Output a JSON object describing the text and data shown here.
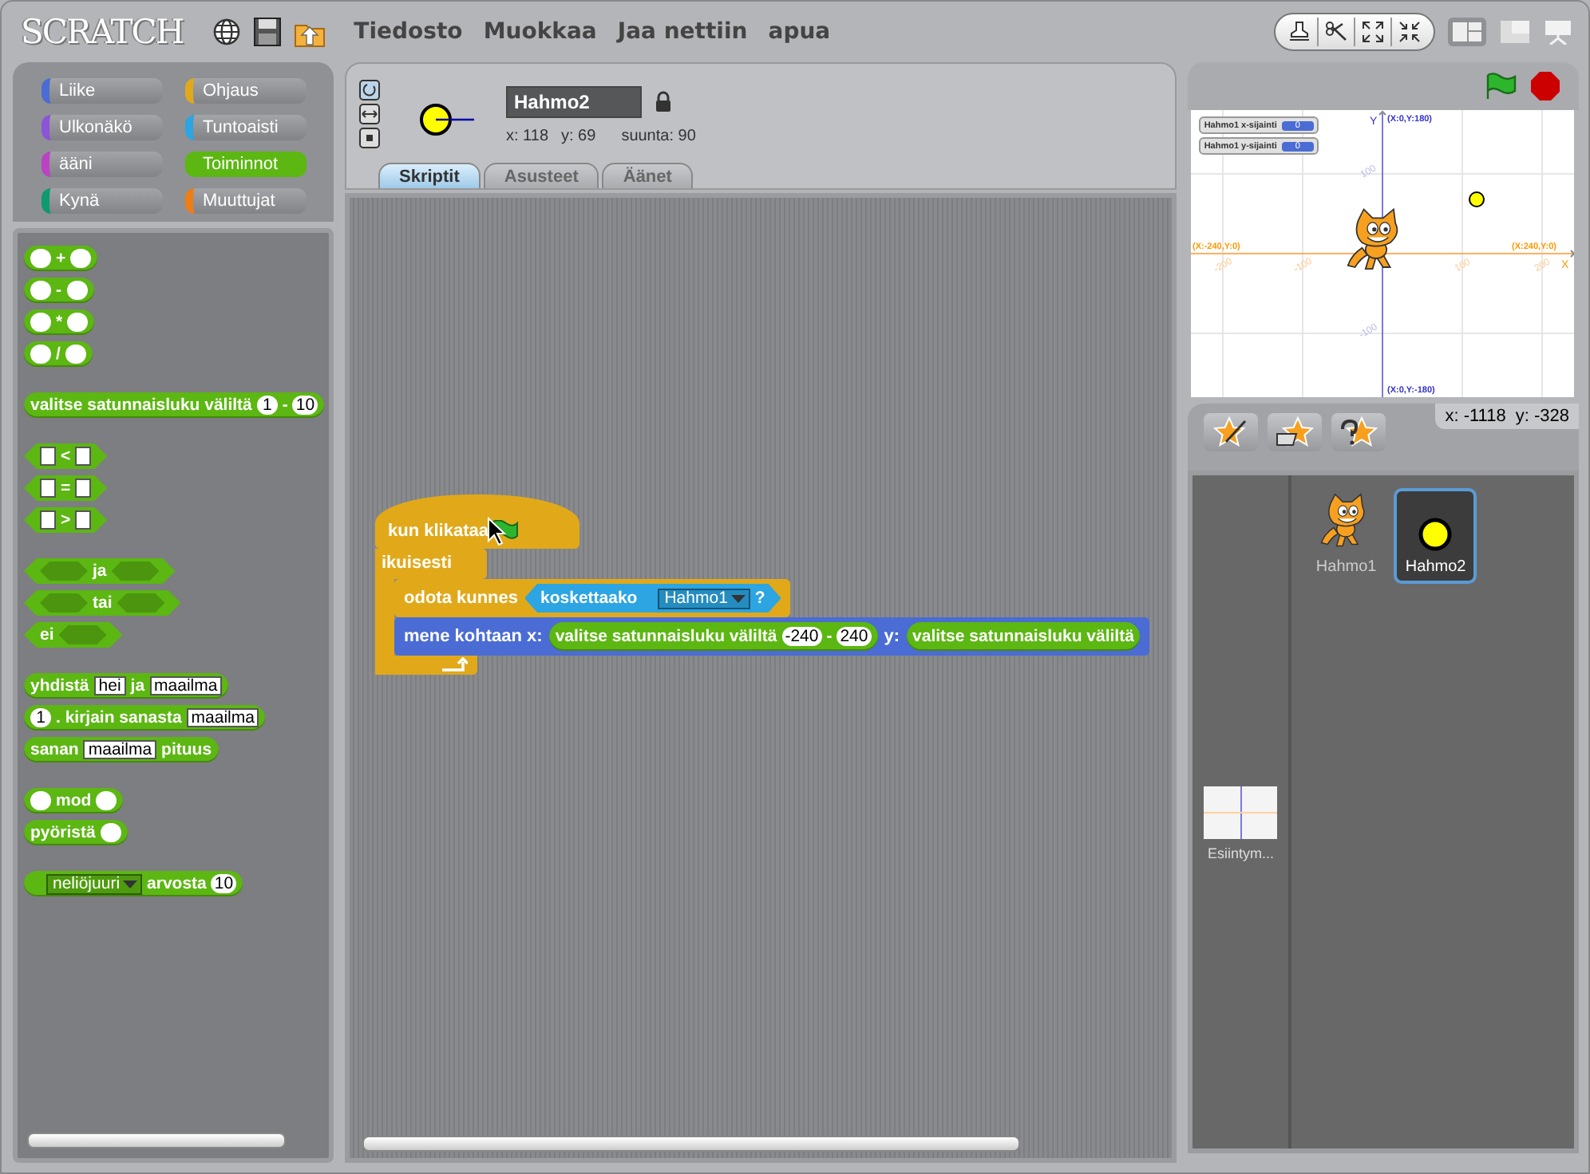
{
  "logo": "SCRATCH",
  "menu": [
    {
      "label": "Tiedosto"
    },
    {
      "label": "Muokkaa"
    },
    {
      "label": "Jaa nettiin"
    },
    {
      "label": "apua"
    }
  ],
  "categories": [
    {
      "label": "Liike",
      "color": "#4a6cd4",
      "selected": false
    },
    {
      "label": "Ulkonäkö",
      "color": "#8a55d7",
      "selected": false
    },
    {
      "label": "ääni",
      "color": "#bb42c3",
      "selected": false
    },
    {
      "label": "Kynä",
      "color": "#0e9a6c",
      "selected": false
    },
    {
      "label": "Ohjaus",
      "color": "#e1a91a",
      "selected": false
    },
    {
      "label": "Tuntoaisti",
      "color": "#2ca5e2",
      "selected": false
    },
    {
      "label": "Toiminnot",
      "color": "#5cb712",
      "selected": true
    },
    {
      "label": "Muuttujat",
      "color": "#ee7d16",
      "selected": false
    }
  ],
  "palette": [
    [
      {
        "kind": "reporter",
        "parts": [
          {
            "kind": "num"
          },
          {
            "kind": "text",
            "text": "+"
          },
          {
            "kind": "num"
          }
        ]
      },
      {
        "kind": "reporter",
        "parts": [
          {
            "kind": "num"
          },
          {
            "kind": "text",
            "text": "-"
          },
          {
            "kind": "num"
          }
        ]
      },
      {
        "kind": "reporter",
        "parts": [
          {
            "kind": "num"
          },
          {
            "kind": "text",
            "text": "*"
          },
          {
            "kind": "num"
          }
        ]
      },
      {
        "kind": "reporter",
        "parts": [
          {
            "kind": "num"
          },
          {
            "kind": "text",
            "text": "/"
          },
          {
            "kind": "num"
          }
        ]
      }
    ],
    [
      {
        "kind": "reporter",
        "parts": [
          {
            "kind": "text",
            "text": "valitse satunnaisluku väliltä"
          },
          {
            "kind": "num",
            "text": "1"
          },
          {
            "kind": "text",
            "text": "-"
          },
          {
            "kind": "num",
            "text": "10"
          }
        ]
      }
    ],
    [
      {
        "kind": "boolean",
        "parts": [
          {
            "kind": "str"
          },
          {
            "kind": "text",
            "text": "<"
          },
          {
            "kind": "str"
          }
        ]
      },
      {
        "kind": "boolean",
        "parts": [
          {
            "kind": "str"
          },
          {
            "kind": "text",
            "text": "="
          },
          {
            "kind": "str"
          }
        ]
      },
      {
        "kind": "boolean",
        "parts": [
          {
            "kind": "str"
          },
          {
            "kind": "text",
            "text": ">"
          },
          {
            "kind": "str"
          }
        ]
      }
    ],
    [
      {
        "kind": "boolean",
        "parts": [
          {
            "kind": "bool"
          },
          {
            "kind": "text",
            "text": "ja"
          },
          {
            "kind": "bool"
          }
        ]
      },
      {
        "kind": "boolean",
        "parts": [
          {
            "kind": "bool"
          },
          {
            "kind": "text",
            "text": "tai"
          },
          {
            "kind": "bool"
          }
        ]
      },
      {
        "kind": "boolean",
        "parts": [
          {
            "kind": "text",
            "text": "ei"
          },
          {
            "kind": "bool"
          }
        ]
      }
    ],
    [
      {
        "kind": "reporter",
        "parts": [
          {
            "kind": "text",
            "text": "yhdistä"
          },
          {
            "kind": "str",
            "text": "hei"
          },
          {
            "kind": "text",
            "text": "ja"
          },
          {
            "kind": "str",
            "text": "maailma"
          }
        ]
      },
      {
        "kind": "reporter",
        "parts": [
          {
            "kind": "num",
            "text": "1"
          },
          {
            "kind": "text",
            "text": ". kirjain sanasta"
          },
          {
            "kind": "str",
            "text": "maailma"
          }
        ]
      },
      {
        "kind": "reporter",
        "parts": [
          {
            "kind": "text",
            "text": "sanan"
          },
          {
            "kind": "str",
            "text": "maailma"
          },
          {
            "kind": "text",
            "text": "pituus"
          }
        ]
      }
    ],
    [
      {
        "kind": "reporter",
        "parts": [
          {
            "kind": "num"
          },
          {
            "kind": "text",
            "text": "mod"
          },
          {
            "kind": "num"
          }
        ]
      },
      {
        "kind": "reporter",
        "parts": [
          {
            "kind": "text",
            "text": "pyöristä"
          },
          {
            "kind": "num"
          }
        ]
      }
    ],
    [
      {
        "kind": "reporter",
        "parts": [
          {
            "kind": "menu",
            "text": "neliöjuuri"
          },
          {
            "kind": "text",
            "text": "arvosta"
          },
          {
            "kind": "num",
            "text": "10"
          }
        ]
      }
    ]
  ],
  "sprite": {
    "name": "Hahmo2",
    "x": "x: 118",
    "y": "y: 69",
    "direction": "suunta: 90"
  },
  "tabs": [
    {
      "label": "Skriptit",
      "selected": true
    },
    {
      "label": "Asusteet",
      "selected": false
    },
    {
      "label": "Äänet",
      "selected": false
    }
  ],
  "script": {
    "hat": {
      "color": "#e1a91a",
      "parts": [
        {
          "kind": "text",
          "text": "kun klikataa"
        }
      ]
    },
    "forever": {
      "color": "#e1a91a",
      "label": "ikuisesti",
      "body": [
        {
          "color": "#e1a91a",
          "parts": [
            {
              "kind": "text",
              "text": "odota kunnes"
            },
            {
              "kind": "boolean",
              "color": "#2ca5e2",
              "parts": [
                {
                  "kind": "text",
                  "text": "koskettaako"
                },
                {
                  "kind": "menu",
                  "text": "Hahmo1"
                },
                {
                  "kind": "text",
                  "text": "?"
                }
              ]
            }
          ]
        },
        {
          "color": "#4a6cd4",
          "parts": [
            {
              "kind": "text",
              "text": "mene kohtaan x:"
            },
            {
              "kind": "reporter",
              "color": "#5cb712",
              "parts": [
                {
                  "kind": "text",
                  "text": "valitse satunnaisluku väliltä"
                },
                {
                  "kind": "num",
                  "text": "-240"
                },
                {
                  "kind": "text",
                  "text": "-"
                },
                {
                  "kind": "num",
                  "text": "240"
                }
              ]
            },
            {
              "kind": "text",
              "text": "y:"
            },
            {
              "kind": "reporter",
              "color": "#5cb712",
              "parts": [
                {
                  "kind": "text",
                  "text": "valitse satunnaisluku väliltä"
                }
              ]
            }
          ]
        }
      ]
    }
  },
  "stage": {
    "monitors": [
      {
        "label": "Hahmo1 x-sijainti",
        "value": "0"
      },
      {
        "label": "Hahmo1 y-sijainti",
        "value": "0"
      }
    ],
    "top": "(X:0,Y:180)",
    "bottom": "(X:0,Y:-180)",
    "left": "(X:-240,Y:0)",
    "right": "(X:240,Y:0)",
    "x_axis": "X",
    "y_axis": "Y",
    "x_ticks": [
      "-200",
      "-100",
      "100",
      "200"
    ],
    "y_ticks": [
      "100",
      "-100"
    ]
  },
  "mouse": {
    "x": "x: -1118",
    "y": "y: -328"
  },
  "sprites": [
    {
      "name": "Hahmo1",
      "kind": "cat",
      "selected": false
    },
    {
      "name": "Hahmo2",
      "kind": "ball",
      "selected": true
    }
  ],
  "stage_thumb": {
    "name": "Esiintym..."
  }
}
